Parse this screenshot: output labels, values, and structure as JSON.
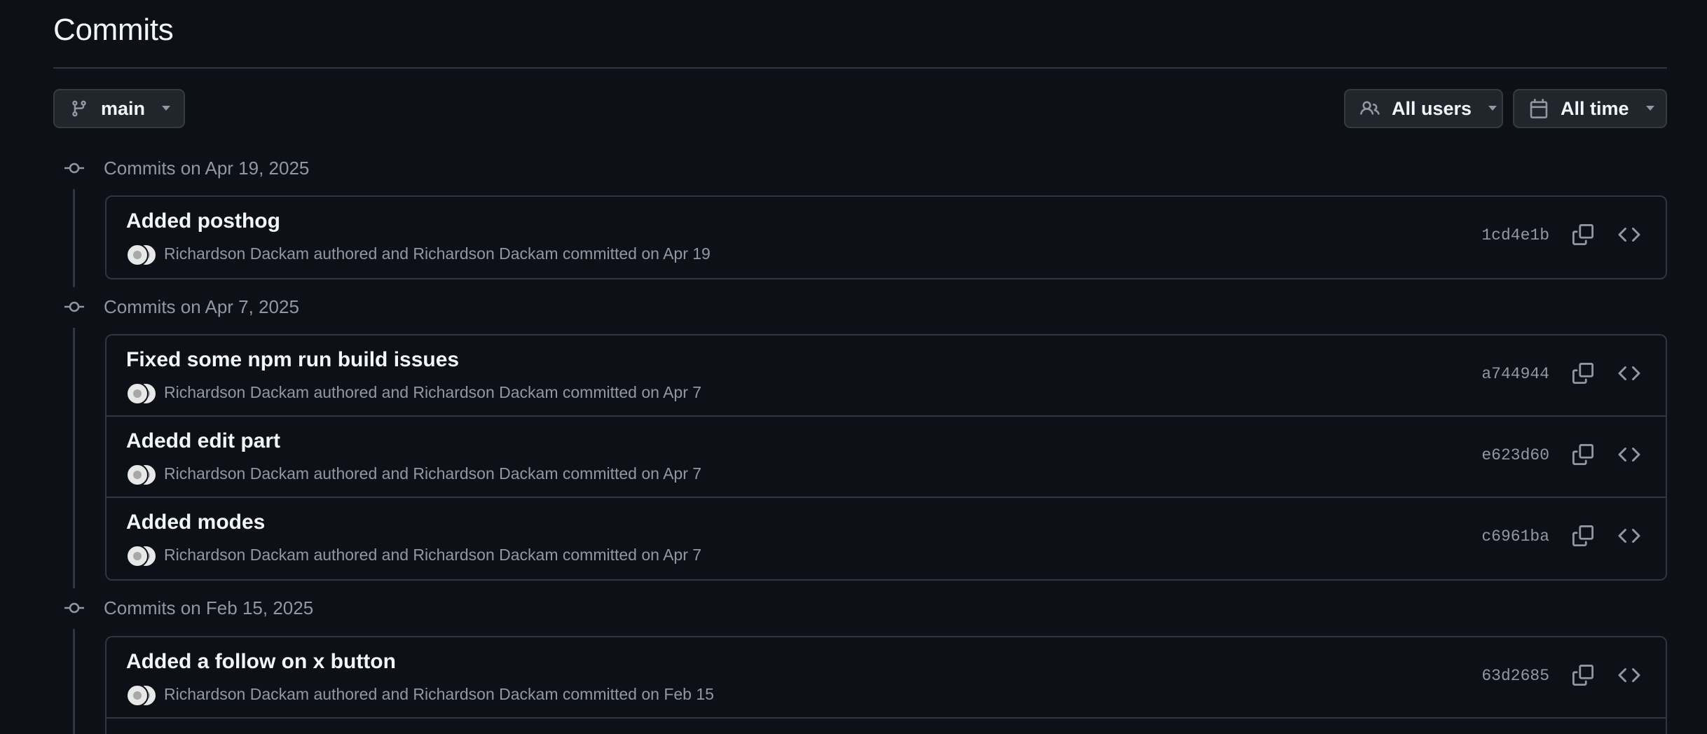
{
  "header": {
    "title": "Commits"
  },
  "filters": {
    "branch_label": "main",
    "users_label": "All users",
    "time_label": "All time"
  },
  "groups": [
    {
      "label": "Commits on Apr 19, 2025",
      "commits": [
        {
          "message": "Added posthog",
          "meta": "Richardson Dackam authored and Richardson Dackam committed on Apr 19",
          "sha": "1cd4e1b"
        }
      ]
    },
    {
      "label": "Commits on Apr 7, 2025",
      "commits": [
        {
          "message": "Fixed some npm run build issues",
          "meta": "Richardson Dackam authored and Richardson Dackam committed on Apr 7",
          "sha": "a744944"
        },
        {
          "message": "Adedd edit part",
          "meta": "Richardson Dackam authored and Richardson Dackam committed on Apr 7",
          "sha": "e623d60"
        },
        {
          "message": "Added modes",
          "meta": "Richardson Dackam authored and Richardson Dackam committed on Apr 7",
          "sha": "c6961ba"
        }
      ]
    },
    {
      "label": "Commits on Feb 15, 2025",
      "commits": [
        {
          "message": "Added a follow on x button",
          "meta": "Richardson Dackam authored and Richardson Dackam committed on Feb 15",
          "sha": "63d2685"
        }
      ]
    }
  ],
  "icons": {
    "branch": "git-branch-icon",
    "users": "people-icon",
    "time": "calendar-icon",
    "caret": "triangle-down-icon",
    "commit_node": "git-commit-icon",
    "copy": "copy-icon",
    "browse": "code-icon"
  },
  "colors": {
    "background": "#0d1117",
    "border": "#30363d",
    "muted_text": "#9198a1",
    "primary_text": "#f0f6fc",
    "button_bg": "#21262d"
  }
}
